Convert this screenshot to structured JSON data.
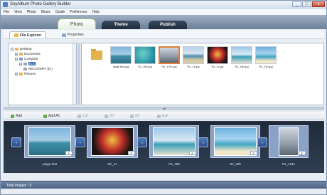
{
  "window": {
    "title": "SoyAlbum Photo Gallery Builder",
    "controls": [
      "_",
      "□",
      "x"
    ]
  },
  "menu": [
    "File",
    "View",
    "Photo",
    "Music",
    "Guide",
    "Preference",
    "Help"
  ],
  "main_tabs": [
    {
      "label": "Photo",
      "active": true
    },
    {
      "label": "Theme",
      "active": false
    },
    {
      "label": "Publish",
      "active": false
    }
  ],
  "sub_tabs": [
    {
      "label": "File Explorer",
      "active": true
    },
    {
      "label": "Properties",
      "active": false
    }
  ],
  "tree": [
    {
      "label": "Desktop",
      "expander": "−",
      "icon": "folder"
    },
    {
      "label": "Documents",
      "expander": "+",
      "icon": "folder"
    },
    {
      "label": "Computer",
      "expander": "−",
      "icon": "pc"
    },
    {
      "label": "(C:)",
      "expander": "+",
      "icon": "disk",
      "selected": true
    },
    {
      "label": "RECOVERY (D:)",
      "expander": "",
      "icon": "disk"
    },
    {
      "label": "Pictures",
      "expander": "+",
      "icon": "folder"
    }
  ],
  "files": [
    {
      "caption": "..",
      "kind": "folder"
    },
    {
      "caption": "plage test.jpg",
      "kind": "beach-rocks"
    },
    {
      "caption": "Rz_18b.jpg",
      "kind": "reef"
    },
    {
      "caption": "Rz_1011.jpg",
      "kind": "city",
      "selected": true
    },
    {
      "caption": "Rz_13.jpg",
      "kind": "coast"
    },
    {
      "caption": "Rz_11.jpg",
      "kind": "carnival"
    },
    {
      "caption": "Rz_18b.jpg",
      "kind": "resort"
    },
    {
      "caption": "Rz_23b.jpg",
      "kind": "palm-beach"
    }
  ],
  "toolbar": [
    {
      "label": "Add",
      "enabled": true
    },
    {
      "label": "Add All",
      "enabled": true
    },
    {
      "label": "Cut",
      "enabled": false
    },
    {
      "label": "90°",
      "enabled": false
    },
    {
      "label": "90°",
      "enabled": false
    },
    {
      "label": "Edit",
      "enabled": false
    }
  ],
  "album": [
    {
      "caption": "plage test",
      "duration": "2\""
    },
    {
      "caption": "Rz_11",
      "duration": "2\""
    },
    {
      "caption": "Rz_18b",
      "duration": "2\""
    },
    {
      "caption": "Rz_23b",
      "duration": "2\""
    },
    {
      "caption": "Rz_1011",
      "duration": "2\""
    }
  ],
  "transition_label": "T",
  "status": "Total Images : 5",
  "colors": {
    "accent": "#3a6db5",
    "selection": "#e07e3c",
    "album_bg": "#1f2b3b"
  }
}
